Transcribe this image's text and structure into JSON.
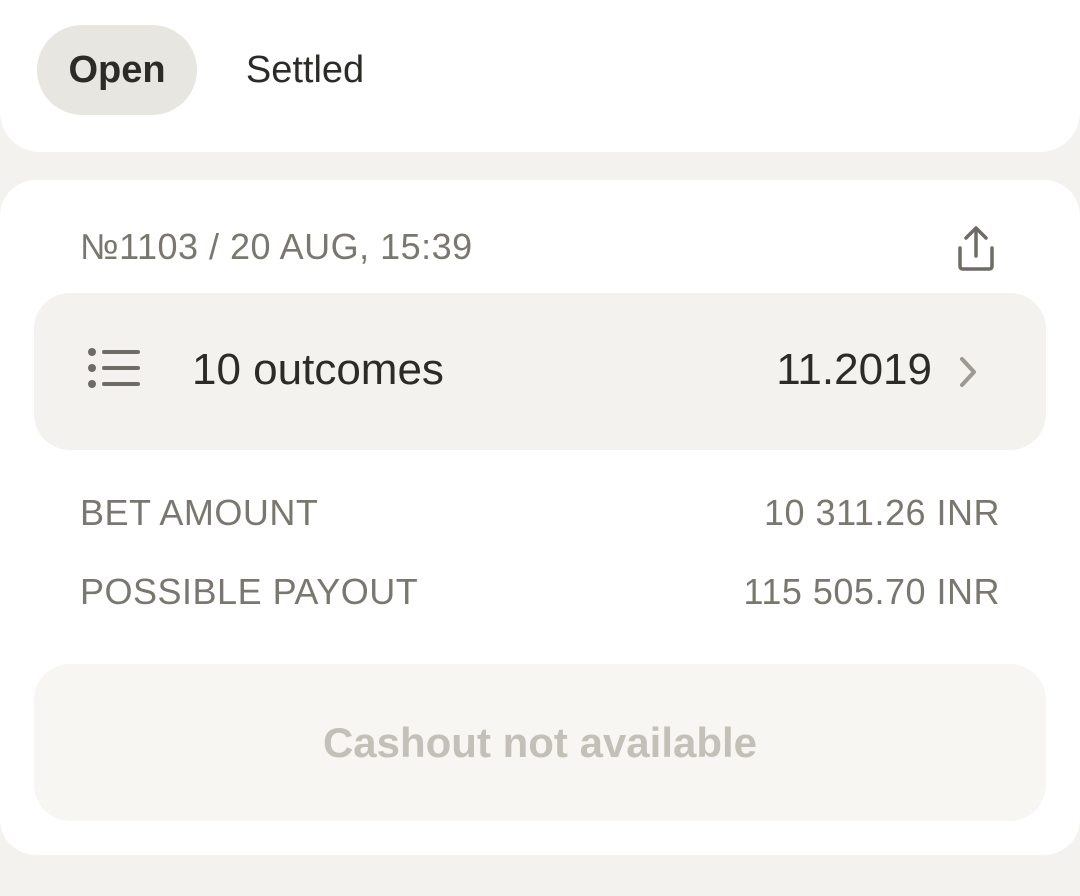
{
  "tabs": [
    {
      "label": "Open",
      "active": true
    },
    {
      "label": "Settled",
      "active": false
    }
  ],
  "bet": {
    "meta": "№1103 / 20 AUG, 15:39",
    "share_icon": "share-icon",
    "outcomes": {
      "icon": "list-icon",
      "label": "10 outcomes",
      "odds": "11.2019",
      "chevron_icon": "chevron-right-icon"
    },
    "bet_amount_label": "BET AMOUNT",
    "bet_amount_value": "10 311.26 INR",
    "payout_label": "POSSIBLE PAYOUT",
    "payout_value": "115 505.70 INR",
    "cashout_label": "Cashout not available"
  },
  "colors": {
    "background": "#f3f2ee",
    "card": "#ffffff",
    "active_tab": "#e7e6e1",
    "muted_text": "#7a776f",
    "disabled_text": "#c3c0b8"
  }
}
